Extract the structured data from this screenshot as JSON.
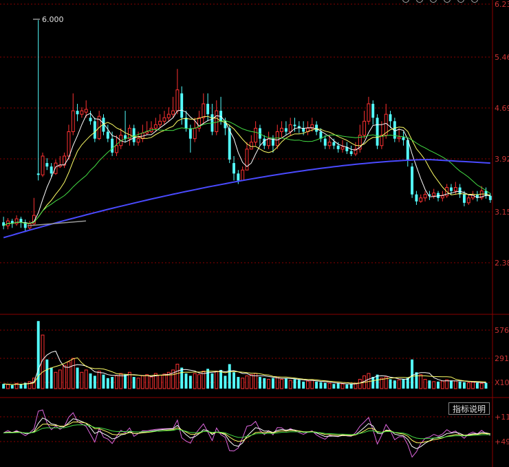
{
  "price_axis": {
    "ticks": [
      "6.23",
      "5.46",
      "4.69",
      "3.92",
      "3.15",
      "2.38"
    ]
  },
  "volume_axis": {
    "ticks": [
      "576",
      "291",
      "X10"
    ]
  },
  "indicator_axis": {
    "ticks": [
      "+11",
      "+49"
    ]
  },
  "peak_label": "6.000",
  "indicator_button_label": "指标说明",
  "toolbar_icons": [
    "settings-icon",
    "pin-icon",
    "window-icon",
    "link-icon",
    "zoom-icon",
    "close-icon"
  ],
  "colors": {
    "up": "#ff3232",
    "down": "#54ffff",
    "ma5": "#ffffff",
    "ma10": "#ffff66",
    "ma20": "#44dd44",
    "ma60": "#4a4aff",
    "grid": "#8b0000",
    "axis_text": "#cc3333"
  },
  "chart_data": [
    {
      "type": "candlestick",
      "panel": "price",
      "ylim": [
        1.8,
        6.23
      ],
      "candles": [
        [
          3.1,
          3.05,
          3.18,
          3.0
        ],
        [
          3.05,
          3.12,
          3.16,
          3.0
        ],
        [
          3.12,
          3.08,
          3.15,
          3.02
        ],
        [
          3.08,
          3.15,
          3.2,
          3.05
        ],
        [
          3.15,
          3.1,
          3.18,
          3.02
        ],
        [
          3.1,
          3.02,
          3.14,
          2.96
        ],
        [
          3.02,
          3.08,
          3.12,
          2.98
        ],
        [
          3.08,
          3.2,
          3.45,
          3.05
        ],
        [
          3.8,
          3.78,
          6.0,
          3.7
        ],
        [
          3.78,
          4.05,
          4.1,
          3.75
        ],
        [
          3.95,
          3.9,
          4.02,
          3.85
        ],
        [
          3.9,
          3.8,
          3.95,
          3.75
        ],
        [
          3.8,
          3.95,
          4.0,
          3.78
        ],
        [
          3.9,
          3.92,
          4.05,
          3.88
        ],
        [
          3.92,
          4.05,
          4.1,
          3.88
        ],
        [
          4.05,
          4.4,
          4.5,
          4.0
        ],
        [
          4.4,
          4.7,
          4.95,
          4.35
        ],
        [
          4.7,
          4.65,
          4.8,
          4.55
        ],
        [
          4.65,
          4.7,
          4.75,
          4.6
        ],
        [
          4.68,
          4.72,
          4.85,
          4.6
        ],
        [
          4.6,
          4.55,
          4.7,
          4.5
        ],
        [
          4.55,
          4.3,
          4.6,
          4.25
        ],
        [
          4.3,
          4.62,
          4.7,
          4.28
        ],
        [
          4.6,
          4.4,
          4.65,
          4.35
        ],
        [
          4.4,
          4.3,
          4.5,
          4.25
        ],
        [
          4.3,
          4.1,
          4.4,
          4.05
        ],
        [
          4.1,
          4.2,
          4.35,
          4.05
        ],
        [
          4.2,
          4.35,
          4.45,
          4.15
        ],
        [
          4.35,
          4.3,
          4.7,
          4.25
        ],
        [
          4.3,
          4.45,
          4.5,
          4.2
        ],
        [
          4.45,
          4.25,
          4.5,
          4.2
        ],
        [
          4.25,
          4.3,
          4.4,
          4.2
        ],
        [
          4.3,
          4.38,
          4.5,
          4.25
        ],
        [
          4.38,
          4.4,
          4.55,
          4.35
        ],
        [
          4.4,
          4.45,
          4.55,
          4.38
        ],
        [
          4.45,
          4.5,
          4.6,
          4.4
        ],
        [
          4.5,
          4.55,
          4.65,
          4.45
        ],
        [
          4.55,
          4.6,
          4.7,
          4.5
        ],
        [
          4.6,
          4.65,
          4.75,
          4.55
        ],
        [
          4.65,
          4.7,
          4.9,
          4.6
        ],
        [
          4.7,
          5.0,
          5.3,
          4.65
        ],
        [
          4.95,
          4.6,
          5.05,
          4.5
        ],
        [
          4.6,
          4.45,
          4.7,
          4.4
        ],
        [
          4.45,
          4.3,
          4.5,
          4.1
        ],
        [
          4.3,
          4.45,
          4.6,
          4.25
        ],
        [
          4.45,
          4.6,
          4.7,
          4.4
        ],
        [
          4.6,
          4.8,
          4.95,
          4.5
        ],
        [
          4.8,
          4.65,
          4.95,
          4.55
        ],
        [
          4.65,
          4.4,
          4.8,
          4.35
        ],
        [
          4.4,
          4.7,
          4.85,
          4.35
        ],
        [
          4.7,
          4.55,
          4.9,
          4.5
        ],
        [
          4.55,
          4.45,
          4.6,
          4.35
        ],
        [
          4.45,
          4.0,
          4.5,
          3.95
        ],
        [
          3.95,
          3.8,
          4.05,
          3.7
        ],
        [
          3.8,
          3.7,
          3.85,
          3.65
        ],
        [
          3.7,
          3.85,
          3.9,
          3.7
        ],
        [
          3.85,
          4.15,
          4.25,
          3.85
        ],
        [
          4.15,
          4.25,
          4.35,
          4.15
        ],
        [
          4.25,
          4.45,
          4.55,
          4.2
        ],
        [
          4.45,
          4.3,
          4.5,
          4.2
        ],
        [
          4.3,
          4.2,
          4.35,
          4.15
        ],
        [
          4.2,
          4.3,
          4.4,
          4.15
        ],
        [
          4.3,
          4.2,
          4.35,
          4.1
        ],
        [
          4.2,
          4.4,
          4.5,
          4.15
        ],
        [
          4.4,
          4.45,
          4.55,
          4.3
        ],
        [
          4.45,
          4.4,
          4.55,
          4.35
        ],
        [
          4.4,
          4.5,
          4.6,
          4.35
        ],
        [
          4.5,
          4.48,
          4.6,
          4.4
        ],
        [
          4.48,
          4.45,
          4.55,
          4.38
        ],
        [
          4.45,
          4.4,
          4.55,
          4.35
        ],
        [
          4.4,
          4.45,
          4.55,
          4.35
        ],
        [
          4.45,
          4.5,
          4.6,
          4.4
        ],
        [
          4.5,
          4.4,
          4.55,
          4.35
        ],
        [
          4.4,
          4.3,
          4.45,
          4.25
        ],
        [
          4.3,
          4.2,
          4.35,
          4.15
        ],
        [
          4.2,
          4.25,
          4.35,
          4.15
        ],
        [
          4.25,
          4.2,
          4.3,
          4.15
        ],
        [
          4.2,
          4.15,
          4.25,
          4.1
        ],
        [
          4.15,
          4.18,
          4.28,
          4.1
        ],
        [
          4.18,
          4.12,
          4.25,
          4.08
        ],
        [
          4.12,
          4.08,
          4.2,
          4.05
        ],
        [
          4.08,
          4.15,
          4.25,
          4.05
        ],
        [
          4.15,
          4.35,
          4.5,
          4.1
        ],
        [
          4.35,
          4.55,
          4.7,
          4.3
        ],
        [
          4.55,
          4.8,
          4.9,
          4.5
        ],
        [
          4.8,
          4.6,
          4.85,
          4.5
        ],
        [
          4.6,
          4.2,
          4.65,
          4.15
        ],
        [
          4.2,
          4.35,
          4.55,
          4.15
        ],
        [
          4.35,
          4.65,
          4.8,
          4.3
        ],
        [
          4.65,
          4.55,
          4.7,
          4.45
        ],
        [
          4.55,
          4.3,
          4.6,
          4.25
        ],
        [
          4.3,
          4.32,
          4.45,
          4.25
        ],
        [
          4.32,
          4.28,
          4.4,
          4.2
        ],
        [
          4.28,
          4.0,
          4.3,
          3.9
        ],
        [
          3.9,
          3.5,
          3.95,
          3.45
        ],
        [
          3.5,
          3.4,
          3.55,
          3.35
        ],
        [
          3.4,
          3.45,
          3.5,
          3.38
        ],
        [
          3.45,
          3.5,
          3.55,
          3.4
        ],
        [
          3.5,
          3.48,
          3.55,
          3.42
        ],
        [
          3.48,
          3.52,
          3.58,
          3.44
        ],
        [
          3.52,
          3.45,
          3.55,
          3.4
        ],
        [
          3.45,
          3.48,
          3.55,
          3.4
        ],
        [
          3.48,
          3.6,
          3.65,
          3.45
        ],
        [
          3.6,
          3.55,
          3.65,
          3.5
        ],
        [
          3.55,
          3.6,
          3.68,
          3.5
        ],
        [
          3.6,
          3.5,
          3.65,
          3.45
        ],
        [
          3.5,
          3.38,
          3.55,
          3.33
        ],
        [
          3.38,
          3.45,
          3.5,
          3.35
        ],
        [
          3.45,
          3.5,
          3.55,
          3.42
        ],
        [
          3.5,
          3.45,
          3.55,
          3.4
        ],
        [
          3.45,
          3.55,
          3.62,
          3.42
        ],
        [
          3.55,
          3.48,
          3.6,
          3.44
        ],
        [
          3.48,
          3.42,
          3.52,
          3.38
        ]
      ],
      "series": [
        {
          "key": "ma5",
          "period": 5
        },
        {
          "key": "ma10",
          "period": 10
        },
        {
          "key": "ma20",
          "period": 20
        },
        {
          "key": "ma60",
          "values_start": 2.88,
          "values_end": 3.95,
          "peak_index": 98,
          "peak_value": 4.0
        }
      ]
    },
    {
      "type": "bar",
      "panel": "volume",
      "ylim": [
        0,
        620
      ],
      "values": [
        40,
        35,
        30,
        45,
        38,
        50,
        60,
        90,
        580,
        460,
        250,
        180,
        140,
        160,
        200,
        230,
        260,
        180,
        140,
        160,
        130,
        110,
        150,
        120,
        90,
        100,
        110,
        130,
        120,
        140,
        100,
        90,
        110,
        120,
        100,
        130,
        115,
        125,
        140,
        160,
        210,
        180,
        130,
        110,
        130,
        120,
        150,
        170,
        130,
        150,
        160,
        110,
        210,
        140,
        100,
        90,
        110,
        120,
        130,
        100,
        90,
        80,
        90,
        100,
        80,
        90,
        70,
        80,
        75,
        60,
        65,
        70,
        60,
        55,
        50,
        45,
        40,
        45,
        40,
        35,
        40,
        45,
        80,
        110,
        130,
        100,
        120,
        90,
        100,
        80,
        70,
        75,
        80,
        95,
        250,
        140,
        120,
        80,
        70,
        60,
        60,
        65,
        75,
        70,
        65,
        60,
        55,
        50,
        55,
        50,
        45,
        50
      ]
    },
    {
      "type": "line",
      "panel": "indicator",
      "ylim": [
        -40,
        40
      ],
      "series": [
        {
          "key": "fast",
          "color": "#dd66dd"
        },
        {
          "key": "mid",
          "color": "#ffffff"
        },
        {
          "key": "slow",
          "color": "#ffff66"
        },
        {
          "key": "base",
          "color": "#44dd44"
        }
      ],
      "period_count": 112
    }
  ]
}
